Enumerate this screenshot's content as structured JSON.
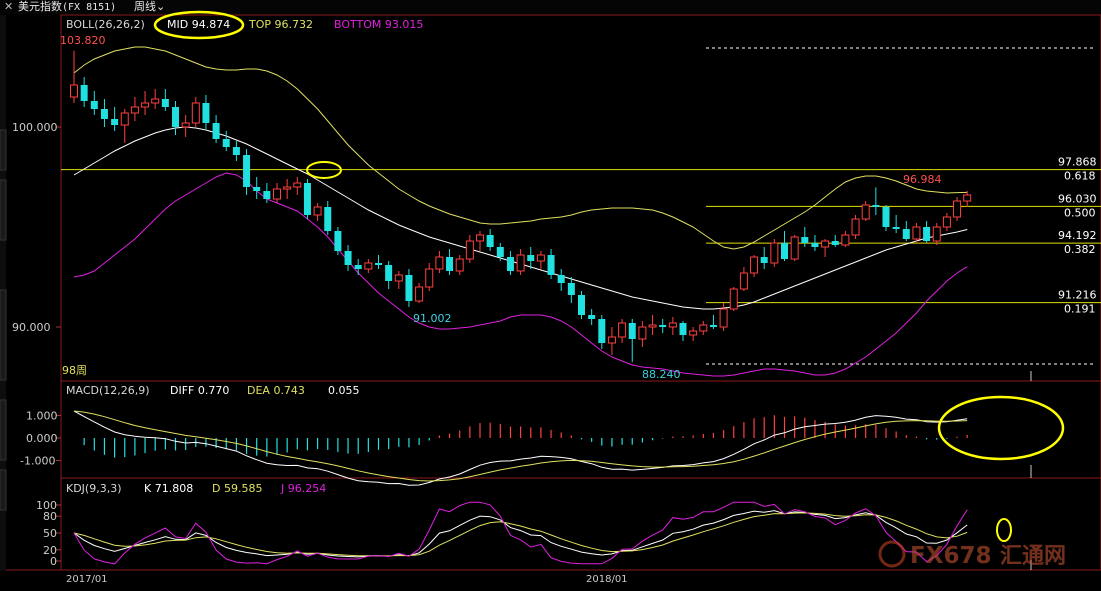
{
  "window": {
    "close_icon": "close-icon",
    "symbol_name": "美元指数",
    "symbol_code": "(FX 8151)",
    "period": "周线",
    "period_icon": "chevron-down-icon"
  },
  "main_panel": {
    "indicator": "BOLL(26,26,2)",
    "mid": "MID 94.874",
    "top": "TOP 96.732",
    "bottom": "BOTTOM 93.015",
    "y_ticks": [
      {
        "value": 100,
        "label": "100.000"
      },
      {
        "value": 90,
        "label": "90.000"
      }
    ],
    "bar_count_label": "98周",
    "price_labels": {
      "high": "103.820",
      "low1": "91.002",
      "low2": "88.240",
      "recent_high": "96.984"
    },
    "fib_levels": [
      {
        "value": 97.868,
        "label": "97.868",
        "ratio": "0.618"
      },
      {
        "value": 96.03,
        "label": "96.030",
        "ratio": "0.500"
      },
      {
        "value": 94.192,
        "label": "94.192",
        "ratio": "0.382"
      },
      {
        "value": 91.216,
        "label": "91.216",
        "ratio": "0.191"
      }
    ],
    "colors": {
      "up": "#ff4040",
      "down": "#20e0e0",
      "mid": "#ffffff",
      "top": "#e0e060",
      "bottom": "#e020e0",
      "fib": "#e0e000",
      "highlight": "#ffff00"
    }
  },
  "macd_panel": {
    "indicator": "MACD(12,26,9)",
    "diff": "DIFF 0.770",
    "dea": "DEA 0.743",
    "macd": "0.055",
    "y_ticks": [
      "1.000",
      "0.000",
      "-1.000"
    ]
  },
  "kdj_panel": {
    "indicator": "KDJ(9,3,3)",
    "k": "K 71.808",
    "d": "D 59.585",
    "j": "J 96.254",
    "y_ticks": [
      "100",
      "80",
      "50",
      "20",
      "0"
    ]
  },
  "x_axis": {
    "labels": [
      "2017/01",
      "2018/01"
    ]
  },
  "watermark": {
    "text": "FX678",
    "suffix": "汇通网"
  },
  "chart_data": {
    "type": "candlestick",
    "periodicity": "weekly",
    "series": [
      {
        "name": "OHLC",
        "values": [
          [
            101.5,
            103.82,
            101.2,
            102.1
          ],
          [
            102.1,
            102.5,
            101.0,
            101.3
          ],
          [
            101.3,
            101.8,
            100.6,
            100.9
          ],
          [
            100.9,
            101.4,
            100.0,
            100.4
          ],
          [
            100.4,
            101.0,
            99.8,
            100.1
          ],
          [
            100.1,
            100.9,
            99.2,
            100.7
          ],
          [
            100.7,
            101.5,
            100.3,
            101.0
          ],
          [
            101.0,
            101.8,
            100.6,
            101.2
          ],
          [
            101.2,
            101.9,
            100.9,
            101.4
          ],
          [
            101.4,
            101.9,
            100.8,
            101.0
          ],
          [
            101.0,
            101.3,
            99.6,
            100.0
          ],
          [
            100.0,
            100.6,
            99.5,
            100.2
          ],
          [
            100.2,
            101.5,
            100.0,
            101.2
          ],
          [
            101.2,
            101.6,
            99.9,
            100.2
          ],
          [
            100.2,
            100.6,
            99.2,
            99.4
          ],
          [
            99.4,
            99.8,
            98.8,
            99.0
          ],
          [
            99.0,
            99.3,
            98.3,
            98.6
          ],
          [
            98.6,
            98.9,
            96.6,
            97.0
          ],
          [
            97.0,
            97.5,
            96.4,
            96.8
          ],
          [
            96.8,
            97.2,
            96.2,
            96.4
          ],
          [
            96.4,
            97.2,
            96.2,
            96.9
          ],
          [
            96.9,
            97.4,
            96.4,
            97.0
          ],
          [
            97.0,
            97.5,
            96.6,
            97.2
          ],
          [
            97.2,
            97.4,
            95.4,
            95.6
          ],
          [
            95.6,
            96.2,
            95.3,
            96.0
          ],
          [
            96.0,
            96.3,
            94.6,
            94.8
          ],
          [
            94.8,
            95.0,
            93.6,
            93.8
          ],
          [
            93.8,
            94.1,
            92.8,
            93.1
          ],
          [
            93.1,
            93.4,
            92.6,
            92.9
          ],
          [
            92.9,
            93.4,
            92.7,
            93.2
          ],
          [
            93.2,
            93.6,
            92.9,
            93.1
          ],
          [
            93.1,
            93.3,
            91.9,
            92.3
          ],
          [
            92.3,
            92.8,
            91.9,
            92.6
          ],
          [
            92.6,
            92.9,
            91.002,
            91.3
          ],
          [
            91.3,
            92.2,
            91.2,
            92.0
          ],
          [
            92.0,
            93.2,
            91.8,
            92.9
          ],
          [
            92.9,
            93.8,
            92.7,
            93.5
          ],
          [
            93.5,
            93.9,
            92.6,
            92.8
          ],
          [
            92.8,
            93.6,
            92.6,
            93.4
          ],
          [
            93.4,
            94.6,
            93.2,
            94.3
          ],
          [
            94.3,
            94.8,
            93.8,
            94.6
          ],
          [
            94.6,
            94.9,
            93.8,
            94.0
          ],
          [
            94.0,
            94.2,
            93.3,
            93.5
          ],
          [
            93.5,
            93.8,
            92.6,
            92.8
          ],
          [
            92.8,
            93.9,
            92.6,
            93.6
          ],
          [
            93.6,
            94.0,
            92.9,
            93.3
          ],
          [
            93.3,
            93.8,
            92.9,
            93.6
          ],
          [
            93.6,
            93.9,
            92.4,
            92.6
          ],
          [
            92.6,
            92.9,
            91.8,
            92.2
          ],
          [
            92.2,
            92.5,
            91.2,
            91.6
          ],
          [
            91.6,
            91.8,
            90.4,
            90.6
          ],
          [
            90.6,
            90.9,
            90.1,
            90.4
          ],
          [
            90.4,
            90.6,
            88.9,
            89.2
          ],
          [
            89.2,
            90.0,
            88.6,
            89.5
          ],
          [
            89.5,
            90.4,
            89.2,
            90.2
          ],
          [
            90.2,
            90.4,
            88.24,
            89.4
          ],
          [
            89.4,
            90.3,
            89.0,
            90.0
          ],
          [
            90.0,
            90.6,
            89.6,
            90.1
          ],
          [
            90.1,
            90.4,
            89.7,
            90.0
          ],
          [
            90.0,
            90.5,
            89.6,
            90.2
          ],
          [
            90.2,
            90.3,
            89.3,
            89.6
          ],
          [
            89.6,
            90.0,
            89.3,
            89.8
          ],
          [
            89.8,
            90.3,
            89.6,
            90.1
          ],
          [
            90.1,
            90.6,
            89.9,
            90.0
          ],
          [
            90.0,
            91.2,
            89.8,
            90.9
          ],
          [
            90.9,
            92.0,
            90.8,
            91.9
          ],
          [
            91.9,
            93.0,
            91.8,
            92.7
          ],
          [
            92.7,
            93.6,
            92.5,
            93.5
          ],
          [
            93.5,
            94.0,
            92.9,
            93.2
          ],
          [
            93.2,
            94.4,
            93.0,
            94.2
          ],
          [
            94.2,
            94.8,
            93.3,
            93.4
          ],
          [
            93.4,
            94.6,
            93.3,
            94.5
          ],
          [
            94.5,
            95.0,
            94.0,
            94.2
          ],
          [
            94.2,
            94.6,
            93.8,
            94.0
          ],
          [
            94.0,
            94.4,
            93.5,
            94.3
          ],
          [
            94.3,
            94.6,
            94.0,
            94.1
          ],
          [
            94.1,
            94.8,
            94.0,
            94.6
          ],
          [
            94.6,
            95.6,
            94.4,
            95.4
          ],
          [
            95.4,
            96.3,
            95.3,
            96.1
          ],
          [
            96.1,
            96.984,
            95.6,
            96.0
          ],
          [
            96.0,
            96.1,
            94.8,
            95.0
          ],
          [
            95.0,
            95.6,
            94.7,
            94.9
          ],
          [
            94.9,
            95.3,
            94.3,
            94.4
          ],
          [
            94.4,
            95.2,
            94.2,
            95.0
          ],
          [
            95.0,
            95.3,
            94.2,
            94.3
          ],
          [
            94.3,
            95.2,
            94.1,
            95.0
          ],
          [
            95.0,
            95.7,
            94.8,
            95.5
          ],
          [
            95.5,
            96.5,
            95.3,
            96.3
          ],
          [
            96.3,
            96.8,
            96.0,
            96.6
          ]
        ]
      },
      {
        "name": "MID",
        "values": [
          97.6,
          97.9,
          98.2,
          98.5,
          98.8,
          99.05,
          99.3,
          99.5,
          99.7,
          99.85,
          99.95,
          100.0,
          99.95,
          99.85,
          99.7,
          99.55,
          99.35,
          99.15,
          98.9,
          98.65,
          98.4,
          98.15,
          97.9,
          97.65,
          97.35,
          97.05,
          96.75,
          96.45,
          96.15,
          95.85,
          95.6,
          95.35,
          95.1,
          94.9,
          94.7,
          94.5,
          94.35,
          94.2,
          94.05,
          93.9,
          93.75,
          93.6,
          93.45,
          93.3,
          93.15,
          93.0,
          92.85,
          92.7,
          92.55,
          92.4,
          92.25,
          92.1,
          91.95,
          91.8,
          91.65,
          91.5,
          91.4,
          91.3,
          91.2,
          91.1,
          91.0,
          90.95,
          90.9,
          90.9,
          90.95,
          91.0,
          91.1,
          91.25,
          91.45,
          91.65,
          91.85,
          92.05,
          92.25,
          92.45,
          92.65,
          92.85,
          93.05,
          93.25,
          93.45,
          93.65,
          93.85,
          94.0,
          94.15,
          94.3,
          94.45,
          94.55,
          94.65,
          94.75,
          94.874
        ]
      },
      {
        "name": "TOP",
        "values": [
          102.7,
          103.1,
          103.4,
          103.6,
          103.8,
          103.9,
          104.0,
          104.0,
          103.9,
          103.8,
          103.6,
          103.4,
          103.2,
          103.0,
          102.9,
          102.85,
          102.85,
          102.9,
          102.9,
          102.8,
          102.6,
          102.3,
          101.9,
          101.4,
          100.9,
          100.3,
          99.7,
          99.1,
          98.6,
          98.1,
          97.7,
          97.3,
          96.9,
          96.6,
          96.3,
          96.05,
          95.85,
          95.65,
          95.5,
          95.35,
          95.2,
          95.15,
          95.15,
          95.2,
          95.25,
          95.3,
          95.4,
          95.45,
          95.5,
          95.6,
          95.75,
          95.85,
          95.9,
          95.95,
          95.95,
          95.95,
          95.9,
          95.85,
          95.7,
          95.5,
          95.25,
          95.0,
          94.65,
          94.3,
          94.0,
          93.9,
          94.0,
          94.25,
          94.55,
          94.85,
          95.15,
          95.45,
          95.75,
          96.1,
          96.5,
          96.9,
          97.25,
          97.45,
          97.55,
          97.55,
          97.45,
          97.3,
          97.1,
          96.9,
          96.8,
          96.75,
          96.7,
          96.72,
          96.732
        ]
      },
      {
        "name": "BOTTOM",
        "values": [
          92.5,
          92.6,
          92.8,
          93.2,
          93.6,
          94.0,
          94.4,
          94.9,
          95.4,
          95.9,
          96.3,
          96.6,
          96.9,
          97.2,
          97.5,
          97.7,
          97.6,
          97.3,
          96.8,
          96.4,
          96.2,
          96.0,
          95.8,
          95.4,
          95.0,
          94.5,
          93.9,
          93.3,
          92.7,
          92.2,
          91.7,
          91.3,
          90.9,
          90.5,
          90.2,
          90.0,
          89.9,
          89.9,
          89.95,
          90.0,
          90.1,
          90.2,
          90.3,
          90.5,
          90.6,
          90.6,
          90.6,
          90.5,
          90.3,
          90.0,
          89.6,
          89.2,
          88.8,
          88.5,
          88.3,
          88.1,
          88.0,
          87.95,
          87.9,
          87.8,
          87.7,
          87.65,
          87.6,
          87.55,
          87.55,
          87.6,
          87.7,
          87.8,
          87.9,
          87.9,
          87.85,
          87.8,
          87.7,
          87.6,
          87.6,
          87.7,
          87.9,
          88.2,
          88.5,
          88.9,
          89.3,
          89.7,
          90.2,
          90.7,
          91.3,
          91.8,
          92.3,
          92.7,
          93.015
        ]
      }
    ],
    "y_axis": {
      "ticks": [
        100,
        90
      ]
    },
    "x_axis": {
      "labels": [
        "2017/01",
        "2018/01"
      ]
    },
    "annotations": [
      "103.820",
      "91.002",
      "88.240",
      "96.984",
      "97.868",
      "0.618",
      "96.030",
      "0.500",
      "94.192",
      "0.382",
      "91.216",
      "0.191"
    ]
  }
}
